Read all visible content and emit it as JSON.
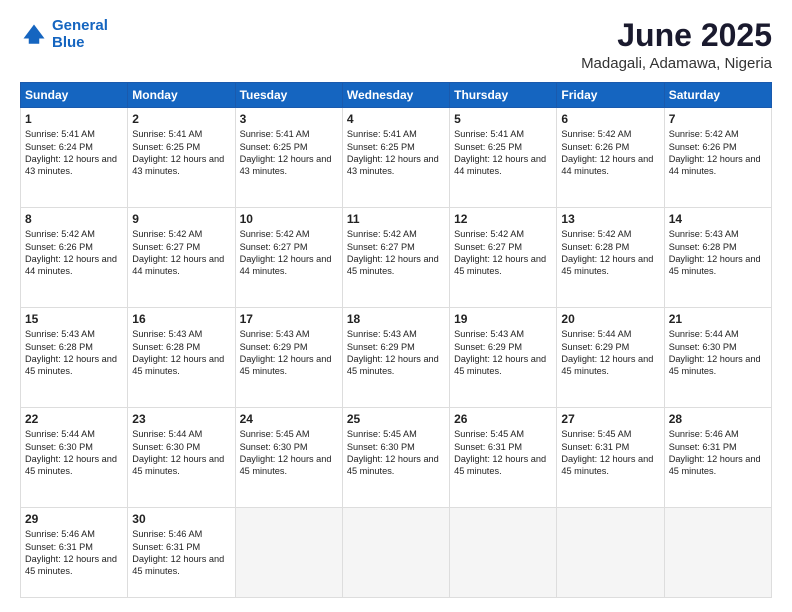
{
  "logo": {
    "line1": "General",
    "line2": "Blue"
  },
  "title": "June 2025",
  "subtitle": "Madagali, Adamawa, Nigeria",
  "days_header": [
    "Sunday",
    "Monday",
    "Tuesday",
    "Wednesday",
    "Thursday",
    "Friday",
    "Saturday"
  ],
  "weeks": [
    [
      {
        "day": "1",
        "sunrise": "5:41 AM",
        "sunset": "6:24 PM",
        "daylight": "12 hours and 43 minutes."
      },
      {
        "day": "2",
        "sunrise": "5:41 AM",
        "sunset": "6:25 PM",
        "daylight": "12 hours and 43 minutes."
      },
      {
        "day": "3",
        "sunrise": "5:41 AM",
        "sunset": "6:25 PM",
        "daylight": "12 hours and 43 minutes."
      },
      {
        "day": "4",
        "sunrise": "5:41 AM",
        "sunset": "6:25 PM",
        "daylight": "12 hours and 43 minutes."
      },
      {
        "day": "5",
        "sunrise": "5:41 AM",
        "sunset": "6:25 PM",
        "daylight": "12 hours and 44 minutes."
      },
      {
        "day": "6",
        "sunrise": "5:42 AM",
        "sunset": "6:26 PM",
        "daylight": "12 hours and 44 minutes."
      },
      {
        "day": "7",
        "sunrise": "5:42 AM",
        "sunset": "6:26 PM",
        "daylight": "12 hours and 44 minutes."
      }
    ],
    [
      {
        "day": "8",
        "sunrise": "5:42 AM",
        "sunset": "6:26 PM",
        "daylight": "12 hours and 44 minutes."
      },
      {
        "day": "9",
        "sunrise": "5:42 AM",
        "sunset": "6:27 PM",
        "daylight": "12 hours and 44 minutes."
      },
      {
        "day": "10",
        "sunrise": "5:42 AM",
        "sunset": "6:27 PM",
        "daylight": "12 hours and 44 minutes."
      },
      {
        "day": "11",
        "sunrise": "5:42 AM",
        "sunset": "6:27 PM",
        "daylight": "12 hours and 45 minutes."
      },
      {
        "day": "12",
        "sunrise": "5:42 AM",
        "sunset": "6:27 PM",
        "daylight": "12 hours and 45 minutes."
      },
      {
        "day": "13",
        "sunrise": "5:42 AM",
        "sunset": "6:28 PM",
        "daylight": "12 hours and 45 minutes."
      },
      {
        "day": "14",
        "sunrise": "5:43 AM",
        "sunset": "6:28 PM",
        "daylight": "12 hours and 45 minutes."
      }
    ],
    [
      {
        "day": "15",
        "sunrise": "5:43 AM",
        "sunset": "6:28 PM",
        "daylight": "12 hours and 45 minutes."
      },
      {
        "day": "16",
        "sunrise": "5:43 AM",
        "sunset": "6:28 PM",
        "daylight": "12 hours and 45 minutes."
      },
      {
        "day": "17",
        "sunrise": "5:43 AM",
        "sunset": "6:29 PM",
        "daylight": "12 hours and 45 minutes."
      },
      {
        "day": "18",
        "sunrise": "5:43 AM",
        "sunset": "6:29 PM",
        "daylight": "12 hours and 45 minutes."
      },
      {
        "day": "19",
        "sunrise": "5:43 AM",
        "sunset": "6:29 PM",
        "daylight": "12 hours and 45 minutes."
      },
      {
        "day": "20",
        "sunrise": "5:44 AM",
        "sunset": "6:29 PM",
        "daylight": "12 hours and 45 minutes."
      },
      {
        "day": "21",
        "sunrise": "5:44 AM",
        "sunset": "6:30 PM",
        "daylight": "12 hours and 45 minutes."
      }
    ],
    [
      {
        "day": "22",
        "sunrise": "5:44 AM",
        "sunset": "6:30 PM",
        "daylight": "12 hours and 45 minutes."
      },
      {
        "day": "23",
        "sunrise": "5:44 AM",
        "sunset": "6:30 PM",
        "daylight": "12 hours and 45 minutes."
      },
      {
        "day": "24",
        "sunrise": "5:45 AM",
        "sunset": "6:30 PM",
        "daylight": "12 hours and 45 minutes."
      },
      {
        "day": "25",
        "sunrise": "5:45 AM",
        "sunset": "6:30 PM",
        "daylight": "12 hours and 45 minutes."
      },
      {
        "day": "26",
        "sunrise": "5:45 AM",
        "sunset": "6:31 PM",
        "daylight": "12 hours and 45 minutes."
      },
      {
        "day": "27",
        "sunrise": "5:45 AM",
        "sunset": "6:31 PM",
        "daylight": "12 hours and 45 minutes."
      },
      {
        "day": "28",
        "sunrise": "5:46 AM",
        "sunset": "6:31 PM",
        "daylight": "12 hours and 45 minutes."
      }
    ],
    [
      {
        "day": "29",
        "sunrise": "5:46 AM",
        "sunset": "6:31 PM",
        "daylight": "12 hours and 45 minutes."
      },
      {
        "day": "30",
        "sunrise": "5:46 AM",
        "sunset": "6:31 PM",
        "daylight": "12 hours and 45 minutes."
      },
      null,
      null,
      null,
      null,
      null
    ]
  ]
}
